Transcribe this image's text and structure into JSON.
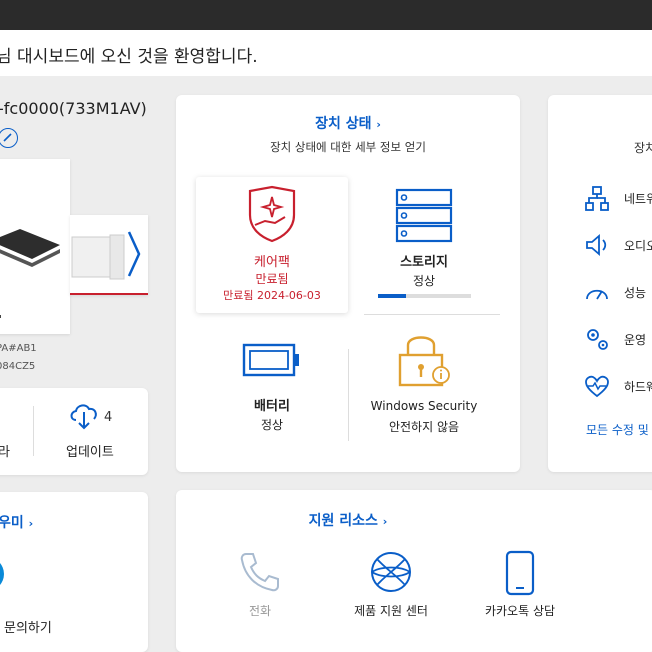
{
  "welcome": {
    "text": "님 대시보드에 오신 것을 환영합니다."
  },
  "device": {
    "model": "-fc0000(733M1AV)",
    "sku_line1": "PA#AB1",
    "sku_line2": "084CZ5",
    "menu_count_label": "",
    "partial_label": "라",
    "updates_label": "업데이트",
    "updates_count": "4"
  },
  "device_status": {
    "title": "장치 상태",
    "title_chevron": "›",
    "subtitle": "장치 상태에 대한 세부 정보 얻기",
    "carepack": {
      "name": "케어팩",
      "status": "만료됨",
      "date": "만료됨 2024-06-03"
    },
    "storage": {
      "name": "스토리지",
      "status": "정상",
      "fill_fraction": 0.3
    },
    "battery": {
      "name": "배터리",
      "status": "정상"
    },
    "security": {
      "name": "Windows Security",
      "status": "안전하지 않음"
    }
  },
  "right_panel": {
    "header_partial": "장치",
    "items": [
      {
        "label": "네트워",
        "icon": "network-icon"
      },
      {
        "label": "오디오",
        "icon": "speaker-icon"
      },
      {
        "label": "성능",
        "icon": "gauge-icon"
      },
      {
        "label": "운영",
        "icon": "gears-icon"
      },
      {
        "label": "하드웨",
        "icon": "heart-pulse-icon"
      }
    ],
    "link_partial": "모든 수정 및"
  },
  "help": {
    "title_partial": "우미",
    "title_chevron": "›",
    "contact_label": "문의하기"
  },
  "support": {
    "title": "지원 리소스",
    "title_chevron": "›",
    "items": [
      {
        "label": "전화",
        "icon": "phone-icon",
        "disabled": true
      },
      {
        "label": "제품 지원 센터",
        "icon": "globe-icon",
        "disabled": false
      },
      {
        "label": "카카오톡 상담",
        "icon": "mobile-icon",
        "disabled": false
      }
    ]
  },
  "colors": {
    "accent": "#0a5ec8",
    "danger": "#c8202e",
    "warning": "#e0a030"
  }
}
